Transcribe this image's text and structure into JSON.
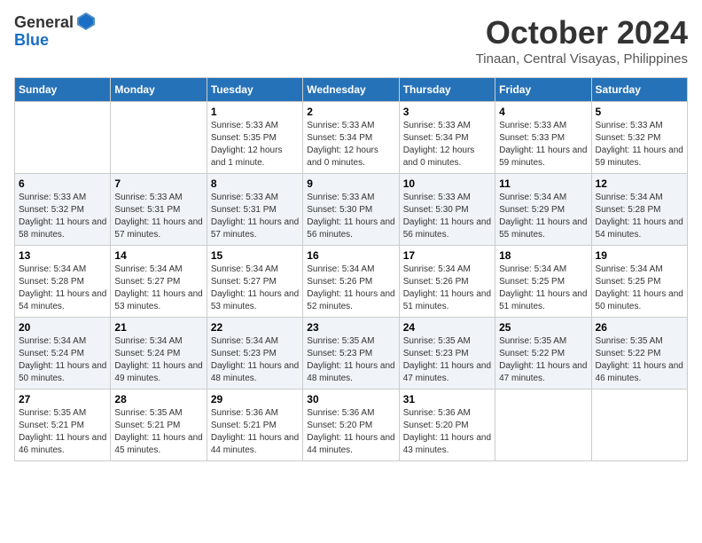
{
  "logo": {
    "general": "General",
    "blue": "Blue"
  },
  "title": "October 2024",
  "subtitle": "Tinaan, Central Visayas, Philippines",
  "days_of_week": [
    "Sunday",
    "Monday",
    "Tuesday",
    "Wednesday",
    "Thursday",
    "Friday",
    "Saturday"
  ],
  "weeks": [
    [
      {
        "day": "",
        "sunrise": "",
        "sunset": "",
        "daylight": ""
      },
      {
        "day": "",
        "sunrise": "",
        "sunset": "",
        "daylight": ""
      },
      {
        "day": "1",
        "sunrise": "Sunrise: 5:33 AM",
        "sunset": "Sunset: 5:35 PM",
        "daylight": "Daylight: 12 hours and 1 minute."
      },
      {
        "day": "2",
        "sunrise": "Sunrise: 5:33 AM",
        "sunset": "Sunset: 5:34 PM",
        "daylight": "Daylight: 12 hours and 0 minutes."
      },
      {
        "day": "3",
        "sunrise": "Sunrise: 5:33 AM",
        "sunset": "Sunset: 5:34 PM",
        "daylight": "Daylight: 12 hours and 0 minutes."
      },
      {
        "day": "4",
        "sunrise": "Sunrise: 5:33 AM",
        "sunset": "Sunset: 5:33 PM",
        "daylight": "Daylight: 11 hours and 59 minutes."
      },
      {
        "day": "5",
        "sunrise": "Sunrise: 5:33 AM",
        "sunset": "Sunset: 5:32 PM",
        "daylight": "Daylight: 11 hours and 59 minutes."
      }
    ],
    [
      {
        "day": "6",
        "sunrise": "Sunrise: 5:33 AM",
        "sunset": "Sunset: 5:32 PM",
        "daylight": "Daylight: 11 hours and 58 minutes."
      },
      {
        "day": "7",
        "sunrise": "Sunrise: 5:33 AM",
        "sunset": "Sunset: 5:31 PM",
        "daylight": "Daylight: 11 hours and 57 minutes."
      },
      {
        "day": "8",
        "sunrise": "Sunrise: 5:33 AM",
        "sunset": "Sunset: 5:31 PM",
        "daylight": "Daylight: 11 hours and 57 minutes."
      },
      {
        "day": "9",
        "sunrise": "Sunrise: 5:33 AM",
        "sunset": "Sunset: 5:30 PM",
        "daylight": "Daylight: 11 hours and 56 minutes."
      },
      {
        "day": "10",
        "sunrise": "Sunrise: 5:33 AM",
        "sunset": "Sunset: 5:30 PM",
        "daylight": "Daylight: 11 hours and 56 minutes."
      },
      {
        "day": "11",
        "sunrise": "Sunrise: 5:34 AM",
        "sunset": "Sunset: 5:29 PM",
        "daylight": "Daylight: 11 hours and 55 minutes."
      },
      {
        "day": "12",
        "sunrise": "Sunrise: 5:34 AM",
        "sunset": "Sunset: 5:28 PM",
        "daylight": "Daylight: 11 hours and 54 minutes."
      }
    ],
    [
      {
        "day": "13",
        "sunrise": "Sunrise: 5:34 AM",
        "sunset": "Sunset: 5:28 PM",
        "daylight": "Daylight: 11 hours and 54 minutes."
      },
      {
        "day": "14",
        "sunrise": "Sunrise: 5:34 AM",
        "sunset": "Sunset: 5:27 PM",
        "daylight": "Daylight: 11 hours and 53 minutes."
      },
      {
        "day": "15",
        "sunrise": "Sunrise: 5:34 AM",
        "sunset": "Sunset: 5:27 PM",
        "daylight": "Daylight: 11 hours and 53 minutes."
      },
      {
        "day": "16",
        "sunrise": "Sunrise: 5:34 AM",
        "sunset": "Sunset: 5:26 PM",
        "daylight": "Daylight: 11 hours and 52 minutes."
      },
      {
        "day": "17",
        "sunrise": "Sunrise: 5:34 AM",
        "sunset": "Sunset: 5:26 PM",
        "daylight": "Daylight: 11 hours and 51 minutes."
      },
      {
        "day": "18",
        "sunrise": "Sunrise: 5:34 AM",
        "sunset": "Sunset: 5:25 PM",
        "daylight": "Daylight: 11 hours and 51 minutes."
      },
      {
        "day": "19",
        "sunrise": "Sunrise: 5:34 AM",
        "sunset": "Sunset: 5:25 PM",
        "daylight": "Daylight: 11 hours and 50 minutes."
      }
    ],
    [
      {
        "day": "20",
        "sunrise": "Sunrise: 5:34 AM",
        "sunset": "Sunset: 5:24 PM",
        "daylight": "Daylight: 11 hours and 50 minutes."
      },
      {
        "day": "21",
        "sunrise": "Sunrise: 5:34 AM",
        "sunset": "Sunset: 5:24 PM",
        "daylight": "Daylight: 11 hours and 49 minutes."
      },
      {
        "day": "22",
        "sunrise": "Sunrise: 5:34 AM",
        "sunset": "Sunset: 5:23 PM",
        "daylight": "Daylight: 11 hours and 48 minutes."
      },
      {
        "day": "23",
        "sunrise": "Sunrise: 5:35 AM",
        "sunset": "Sunset: 5:23 PM",
        "daylight": "Daylight: 11 hours and 48 minutes."
      },
      {
        "day": "24",
        "sunrise": "Sunrise: 5:35 AM",
        "sunset": "Sunset: 5:23 PM",
        "daylight": "Daylight: 11 hours and 47 minutes."
      },
      {
        "day": "25",
        "sunrise": "Sunrise: 5:35 AM",
        "sunset": "Sunset: 5:22 PM",
        "daylight": "Daylight: 11 hours and 47 minutes."
      },
      {
        "day": "26",
        "sunrise": "Sunrise: 5:35 AM",
        "sunset": "Sunset: 5:22 PM",
        "daylight": "Daylight: 11 hours and 46 minutes."
      }
    ],
    [
      {
        "day": "27",
        "sunrise": "Sunrise: 5:35 AM",
        "sunset": "Sunset: 5:21 PM",
        "daylight": "Daylight: 11 hours and 46 minutes."
      },
      {
        "day": "28",
        "sunrise": "Sunrise: 5:35 AM",
        "sunset": "Sunset: 5:21 PM",
        "daylight": "Daylight: 11 hours and 45 minutes."
      },
      {
        "day": "29",
        "sunrise": "Sunrise: 5:36 AM",
        "sunset": "Sunset: 5:21 PM",
        "daylight": "Daylight: 11 hours and 44 minutes."
      },
      {
        "day": "30",
        "sunrise": "Sunrise: 5:36 AM",
        "sunset": "Sunset: 5:20 PM",
        "daylight": "Daylight: 11 hours and 44 minutes."
      },
      {
        "day": "31",
        "sunrise": "Sunrise: 5:36 AM",
        "sunset": "Sunset: 5:20 PM",
        "daylight": "Daylight: 11 hours and 43 minutes."
      },
      {
        "day": "",
        "sunrise": "",
        "sunset": "",
        "daylight": ""
      },
      {
        "day": "",
        "sunrise": "",
        "sunset": "",
        "daylight": ""
      }
    ]
  ]
}
